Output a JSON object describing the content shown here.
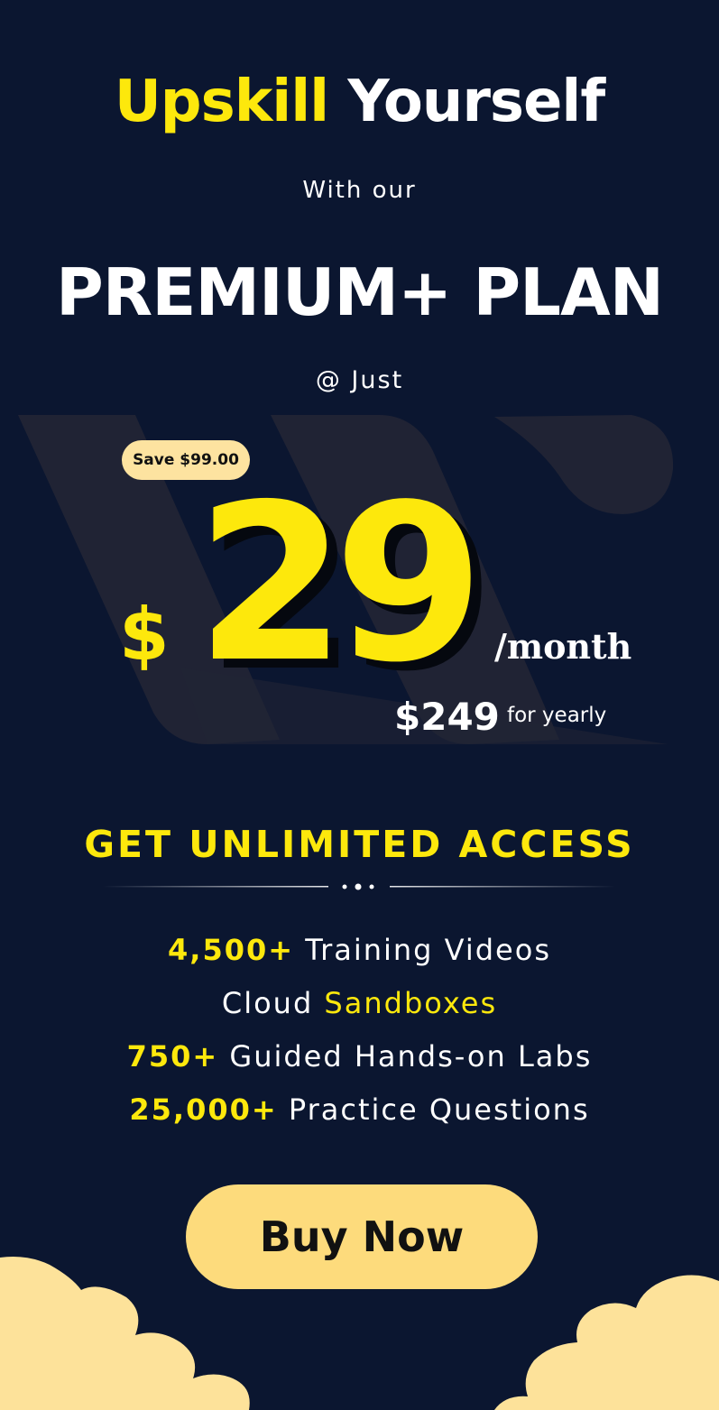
{
  "headline": {
    "part_yellow": "Upskill",
    "part_white": "Yourself"
  },
  "subheading": "With our",
  "plan_name": "PREMIUM+ PLAN",
  "price_intro": "@ Just",
  "price": {
    "save_badge": "Save $99.00",
    "currency_symbol": "$",
    "monthly_amount": "29",
    "period": "/month",
    "yearly_amount": "$249",
    "yearly_label": "for yearly"
  },
  "access": {
    "heading": "GET UNLIMITED ACCESS",
    "features": [
      {
        "highlight": "4,500+",
        "text": "Training Videos"
      },
      {
        "text": "Cloud",
        "highlight": "Sandboxes"
      },
      {
        "highlight": "750+",
        "text": "Guided Hands-on Labs"
      },
      {
        "highlight": "25,000+",
        "text": "Practice Questions"
      }
    ]
  },
  "cta": {
    "label": "Buy Now"
  },
  "colors": {
    "background": "#0b1630",
    "accent_yellow": "#fde80c",
    "badge_cream": "#fde3a0",
    "button_cream": "#fddb7c",
    "cloud_cream": "#fde29a"
  }
}
